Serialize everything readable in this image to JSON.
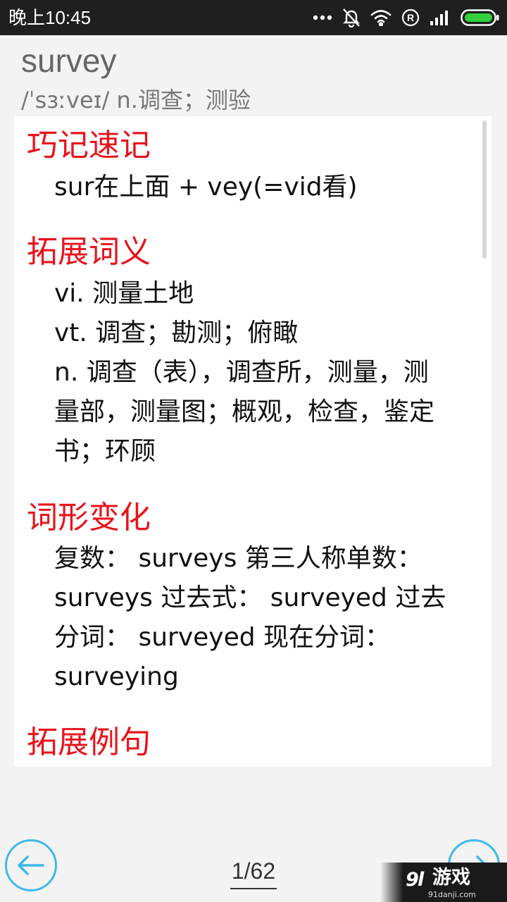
{
  "status_bar": {
    "time": "晚上10:45",
    "icons": [
      "more-dots-icon",
      "notifications-off-icon",
      "wifi-icon",
      "registered-icon",
      "signal-icon",
      "battery-icon"
    ]
  },
  "header": {
    "word": "survey",
    "phonetic": "/ˈsɜːveɪ/ n.调查；测验"
  },
  "sections": [
    {
      "title": "巧记速记",
      "lines": [
        "sur在上面 + vey(=vid看)"
      ]
    },
    {
      "title": "拓展词义",
      "lines": [
        "vi. 测量土地",
        "vt. 调查；勘测；俯瞰",
        "n. 调查（表），调查所，测量，测",
        "量部，测量图；概观，检查，鉴定",
        "书；环顾"
      ]
    },
    {
      "title": "词形变化",
      "lines": [
        "复数： surveys 第三人称单数：",
        "surveys 过去式： surveyed 过去",
        "分词： surveyed 现在分词：",
        "surveying"
      ]
    },
    {
      "title": "拓展例句",
      "lines": []
    }
  ],
  "footer": {
    "page": "1/62",
    "watermark_text": "游戏",
    "watermark_url": "91danji.com"
  },
  "colors": {
    "accent_red": "#e8141c",
    "nav_blue": "#3fb9ea"
  }
}
